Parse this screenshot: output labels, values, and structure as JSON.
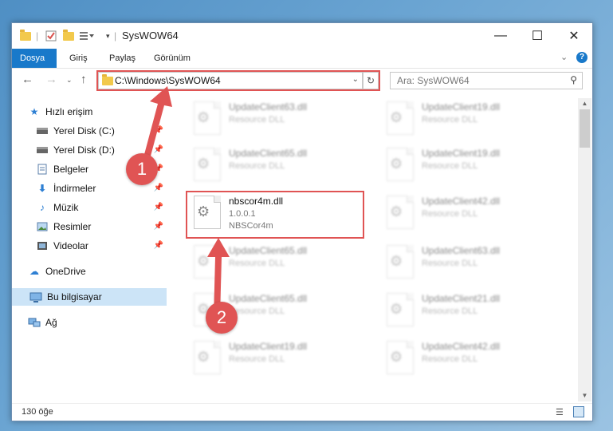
{
  "window": {
    "title": "SysWOW64",
    "controls": {
      "minimize": "—",
      "maximize": "☐",
      "close": "✕"
    }
  },
  "ribbon": {
    "tabs": [
      {
        "label": "Dosya"
      },
      {
        "label": "Giriş"
      },
      {
        "label": "Paylaş"
      },
      {
        "label": "Görünüm"
      }
    ]
  },
  "address": {
    "path": "C:\\Windows\\SysWOW64",
    "search_placeholder": "Ara: SysWOW64"
  },
  "nav_pane": {
    "items": [
      {
        "label": "Hızlı erişim",
        "icon": "star-icon"
      },
      {
        "label": "Yerel Disk (C:)",
        "icon": "drive-icon"
      },
      {
        "label": "Yerel Disk (D:)",
        "icon": "drive-icon"
      },
      {
        "label": "Belgeler",
        "icon": "documents-icon"
      },
      {
        "label": "İndirmeler",
        "icon": "download-icon"
      },
      {
        "label": "Müzik",
        "icon": "music-icon"
      },
      {
        "label": "Resimler",
        "icon": "pictures-icon"
      },
      {
        "label": "Videolar",
        "icon": "video-icon"
      },
      {
        "label": "OneDrive",
        "icon": "cloud-icon"
      },
      {
        "label": "Bu bilgisayar",
        "icon": "computer-icon"
      },
      {
        "label": "Ağ",
        "icon": "network-icon"
      }
    ]
  },
  "files": {
    "left": [
      {
        "name": "UpdateClient63.dll",
        "line1": "Resource DLL",
        "line2": ""
      },
      {
        "name": "UpdateClient65.dll",
        "line1": "Resource DLL",
        "line2": ""
      },
      {
        "name": "nbscor4m.dll",
        "line1": "1.0.0.1",
        "line2": "NBSCor4m"
      },
      {
        "name": "UpdateClient65.dll",
        "line1": "Resource DLL",
        "line2": ""
      },
      {
        "name": "UpdateClient65.dll",
        "line1": "Resource DLL",
        "line2": ""
      },
      {
        "name": "UpdateClient19.dll",
        "line1": "Resource DLL",
        "line2": ""
      }
    ],
    "right": [
      {
        "name": "UpdateClient19.dll",
        "line1": "Resource DLL",
        "line2": ""
      },
      {
        "name": "UpdateClient19.dll",
        "line1": "Resource DLL",
        "line2": ""
      },
      {
        "name": "UpdateClient42.dll",
        "line1": "Resource DLL",
        "line2": ""
      },
      {
        "name": "UpdateClient63.dll",
        "line1": "Resource DLL",
        "line2": ""
      },
      {
        "name": "UpdateClient21.dll",
        "line1": "Resource DLL",
        "line2": ""
      },
      {
        "name": "UpdateClient42.dll",
        "line1": "Resource DLL",
        "line2": ""
      }
    ]
  },
  "status": {
    "count": "130 öğe"
  },
  "callouts": {
    "one": "1",
    "two": "2"
  },
  "colors": {
    "accent": "#1979ca",
    "highlight": "#e05454",
    "selection": "#cce4f7"
  }
}
